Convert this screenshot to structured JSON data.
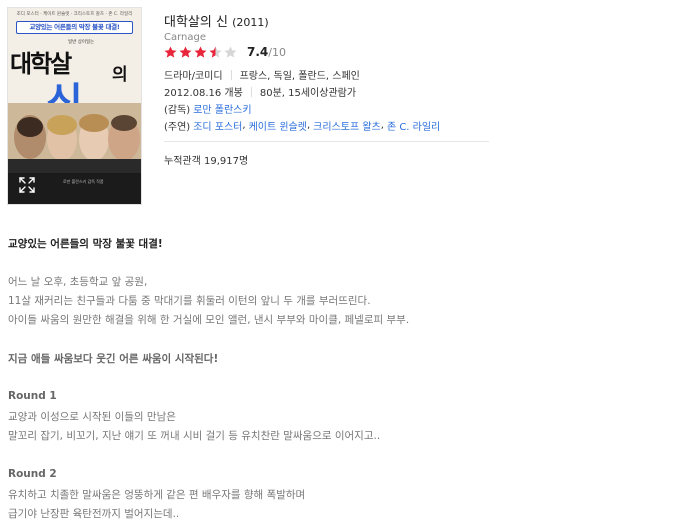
{
  "poster": {
    "top_credits": "조디 포스터 · 케이트 윈슬렛 · 크리스토프 왈츠 · 존 C. 라일리",
    "tagline": "교양있는 어른들의 막장 불꽃 대결!",
    "small_title": "일반 상이일는",
    "title_line1": "대학살",
    "title_eui": "의",
    "title_line2": "신",
    "bottom_credits": "로만 폴란스키 감독 작품",
    "expand_icon": "expand-icon"
  },
  "movie": {
    "title": "대학살의 신",
    "year": "(2011)",
    "original_title": "Carnage",
    "rating": {
      "stars_filled": 3.5,
      "stars_total": 5,
      "score": "7.4",
      "max": "/10",
      "filled_color": "#e8253a",
      "empty_color": "#d6d6d6"
    },
    "genre": "드라마/코미디",
    "countries": "프랑스, 독일, 폴란드, 스페인",
    "release": "2012.08.16 개봉",
    "runtime": "80분, 15세이상관람가",
    "director_label": "(감독)",
    "director": "로만 폴란스키",
    "cast_label": "(주연)",
    "cast": [
      "조디 포스터",
      "케이트 윈슬렛",
      "크리스토프 왈츠",
      "존 C. 라일리"
    ],
    "audience": "누적관객 19,917명",
    "link_color": "#2a6edb"
  },
  "synopsis": [
    {
      "text": "교양있는 어른들의 막장 불꽃 대결!",
      "style": "bold-dark"
    },
    {
      "text": "어느 날 오후, 초등학교 앞 공원,",
      "style": "normal"
    },
    {
      "text": "11살 재커리는 친구들과 다툼 중 막대기를 휘둘러 이턴의 앞니 두 개를 부러뜨린다.",
      "style": "normal"
    },
    {
      "text": "아이들 싸움의 원만한 해결을 위해 한 거실에 모인 앨런, 낸시 부부와 마이클, 페넬로피 부부.",
      "style": "normal"
    },
    {
      "text": "지금 애들 싸움보다 웃긴 어른 싸움이 시작된다!",
      "style": "bold-mid"
    },
    {
      "text": "Round 1",
      "style": "bold-mid"
    },
    {
      "text": "교양과 이성으로 시작된 이들의 만남은",
      "style": "normal"
    },
    {
      "text": "말꼬리 잡기, 비꼬기, 지난 얘기 또 꺼내 시비 걸기 등 유치찬란 말싸움으로 이어지고..",
      "style": "normal"
    },
    {
      "text": "Round 2",
      "style": "bold-mid"
    },
    {
      "text": "유치하고 치졸한 말싸움은 엉뚱하게 같은 편 배우자를 향해 폭발하며",
      "style": "normal"
    },
    {
      "text": "급기야 난장판 육탄전까지 벌어지는데..",
      "style": "normal"
    }
  ]
}
